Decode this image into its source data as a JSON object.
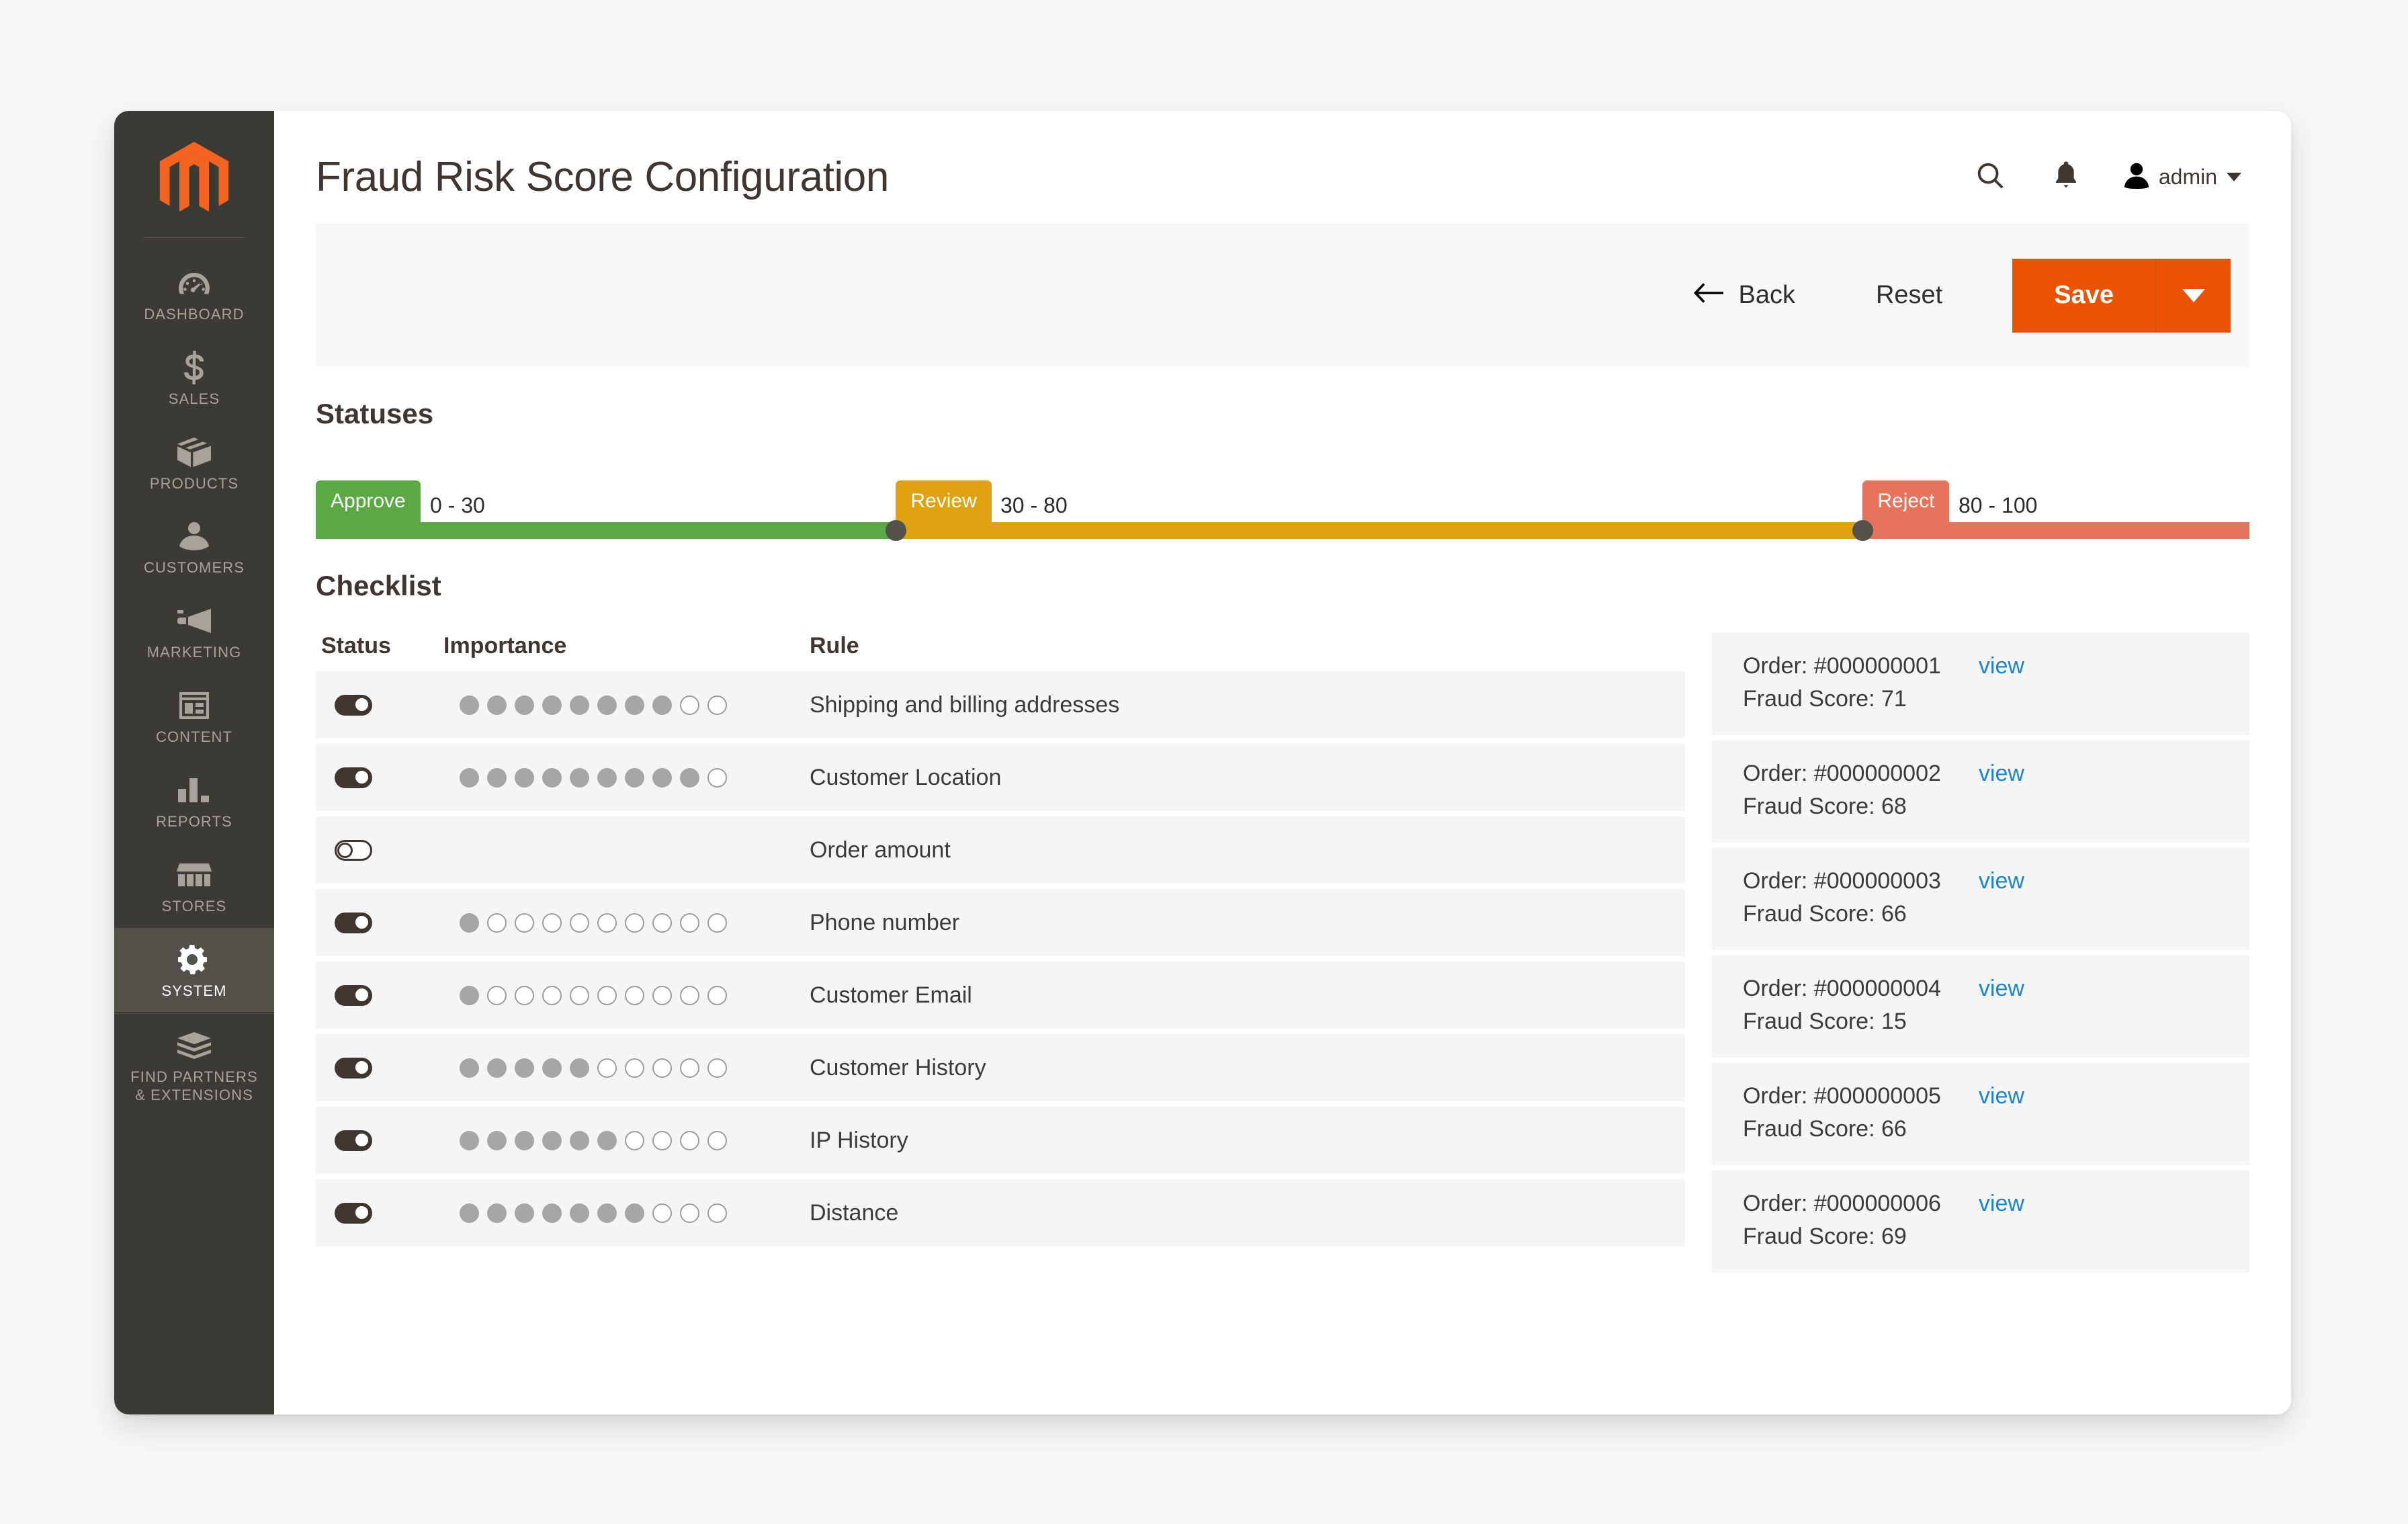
{
  "sidebar": {
    "logo_name": "magento-logo",
    "items": [
      {
        "label": "DASHBOARD",
        "icon": "dashboard-gauge-icon",
        "active": false
      },
      {
        "label": "SALES",
        "icon": "dollar-sign-icon",
        "active": false
      },
      {
        "label": "PRODUCTS",
        "icon": "box-icon",
        "active": false
      },
      {
        "label": "CUSTOMERS",
        "icon": "person-icon",
        "active": false
      },
      {
        "label": "MARKETING",
        "icon": "megaphone-icon",
        "active": false
      },
      {
        "label": "CONTENT",
        "icon": "layout-icon",
        "active": false
      },
      {
        "label": "REPORTS",
        "icon": "bar-chart-icon",
        "active": false
      },
      {
        "label": "STORES",
        "icon": "storefront-icon",
        "active": false
      },
      {
        "label": "SYSTEM",
        "icon": "gear-icon",
        "active": true
      },
      {
        "label": "FIND PARTNERS\n& EXTENSIONS",
        "icon": "partners-box-icon",
        "active": false
      }
    ]
  },
  "header": {
    "title": "Fraud Risk Score Configuration",
    "search_icon": "search-icon",
    "notifications_icon": "bell-icon",
    "avatar_icon": "user-avatar-icon",
    "admin_name": "admin"
  },
  "toolbar": {
    "back_label": "Back",
    "back_icon": "arrow-left-icon",
    "reset_label": "Reset",
    "save_label": "Save",
    "save_split_icon": "chevron-down-icon"
  },
  "statuses": {
    "heading": "Statuses",
    "min": 0,
    "max": 100,
    "segments": [
      {
        "label": "Approve",
        "range": "0 - 30",
        "start": 0,
        "end": 30,
        "color": "#5aa944"
      },
      {
        "label": "Review",
        "range": "30 - 80",
        "start": 30,
        "end": 80,
        "color": "#e0a211"
      },
      {
        "label": "Reject",
        "range": "80 - 100",
        "start": 80,
        "end": 100,
        "color": "#e8735c"
      }
    ],
    "handles": [
      30,
      80
    ],
    "handle_color": "#54504a"
  },
  "checklist": {
    "heading": "Checklist",
    "columns": [
      "Status",
      "Importance",
      "Rule"
    ],
    "importance_max": 10,
    "rows": [
      {
        "enabled": true,
        "importance": 8,
        "rule": "Shipping and billing addresses"
      },
      {
        "enabled": true,
        "importance": 9,
        "rule": "Customer Location"
      },
      {
        "enabled": false,
        "importance": 0,
        "rule": "Order amount"
      },
      {
        "enabled": true,
        "importance": 1,
        "rule": "Phone number"
      },
      {
        "enabled": true,
        "importance": 1,
        "rule": "Customer Email"
      },
      {
        "enabled": true,
        "importance": 5,
        "rule": "Customer History"
      },
      {
        "enabled": true,
        "importance": 6,
        "rule": "IP History"
      },
      {
        "enabled": true,
        "importance": 7,
        "rule": "Distance"
      }
    ]
  },
  "orders": {
    "view_label": "view",
    "items": [
      {
        "id": "Order: #000000001",
        "score": "Fraud Score: 71"
      },
      {
        "id": "Order: #000000002",
        "score": "Fraud Score: 68"
      },
      {
        "id": "Order: #000000003",
        "score": "Fraud Score: 66"
      },
      {
        "id": "Order: #000000004",
        "score": "Fraud Score: 15"
      },
      {
        "id": "Order: #000000005",
        "score": "Fraud Score: 66"
      },
      {
        "id": "Order: #000000006",
        "score": "Fraud Score: 69"
      }
    ]
  },
  "colors": {
    "brand_orange": "#eb5202",
    "sidebar_bg": "#3c3a35",
    "link_blue": "#1a84d6",
    "approve_green": "#5aa944",
    "review_amber": "#e0a211",
    "reject_red": "#e8735c"
  }
}
